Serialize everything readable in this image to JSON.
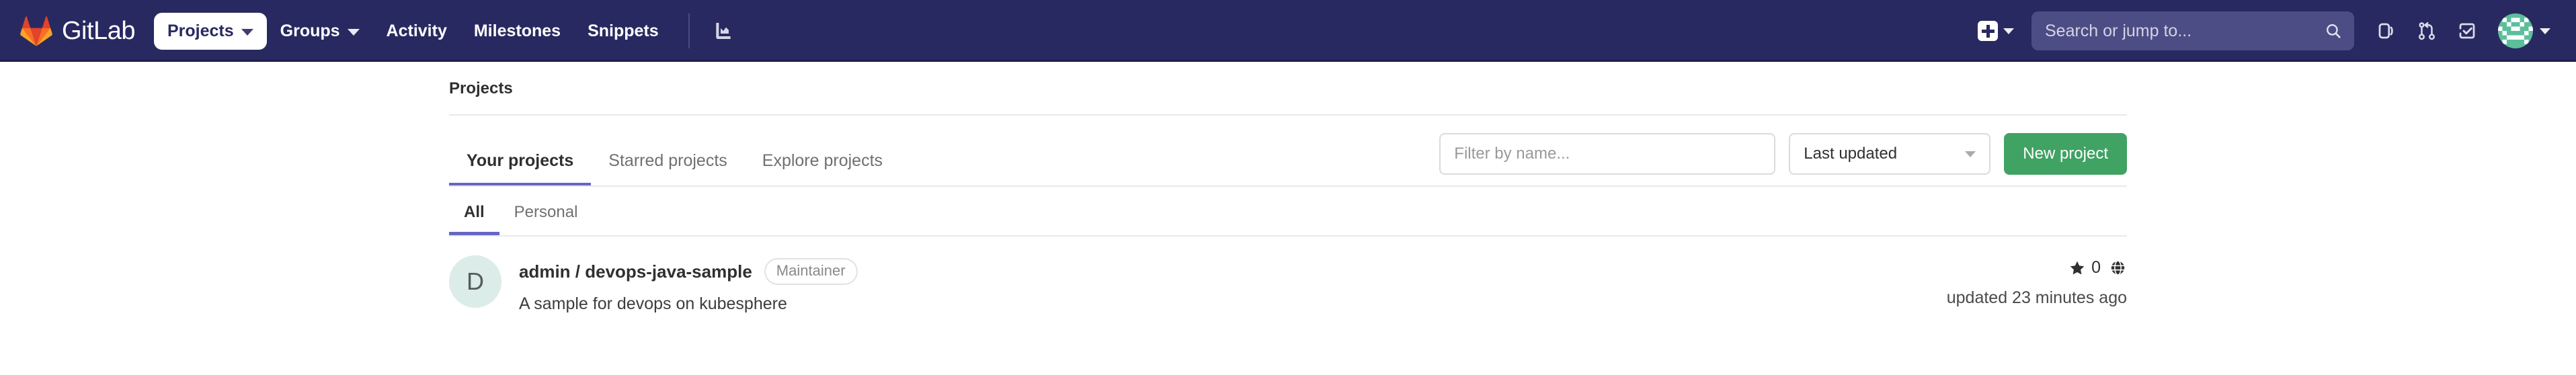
{
  "navbar": {
    "brand_name": "GitLab",
    "brand_icon": "gitlab-tanuki-logo",
    "items": [
      {
        "label": "Projects",
        "icon": "chevron-down-icon",
        "active": true,
        "has_caret": true
      },
      {
        "label": "Groups",
        "icon": "chevron-down-icon",
        "active": false,
        "has_caret": true
      },
      {
        "label": "Activity",
        "active": false,
        "has_caret": false
      },
      {
        "label": "Milestones",
        "active": false,
        "has_caret": false
      },
      {
        "label": "Snippets",
        "active": false,
        "has_caret": false
      }
    ],
    "analytics_icon": "analytics-chart-icon",
    "create_new_icon": "plus-square-icon",
    "create_new_caret_icon": "chevron-down-icon",
    "search": {
      "placeholder": "Search or jump to...",
      "value": "",
      "icon": "search-icon"
    },
    "right_icons": [
      {
        "name": "issues-icon"
      },
      {
        "name": "merge-requests-icon"
      },
      {
        "name": "todos-icon"
      }
    ],
    "avatar": {
      "name": "user-avatar",
      "caret_icon": "chevron-down-icon"
    },
    "bg_color": "#292961",
    "search_bg_color": "#4d4d85"
  },
  "breadcrumb": {
    "label": "Projects"
  },
  "tabs": [
    {
      "label": "Your projects",
      "active": true
    },
    {
      "label": "Starred projects",
      "active": false
    },
    {
      "label": "Explore projects",
      "active": false
    }
  ],
  "filter": {
    "placeholder": "Filter by name...",
    "value": ""
  },
  "sort": {
    "selected": "Last updated",
    "caret_icon": "chevron-down-icon"
  },
  "new_project_button": {
    "label": "New project",
    "color": "#40a263"
  },
  "subtabs": [
    {
      "label": "All",
      "active": true
    },
    {
      "label": "Personal",
      "active": false
    }
  ],
  "projects": [
    {
      "avatar_letter": "D",
      "avatar_bg": "#dcece8",
      "name": "admin / devops-java-sample",
      "role_badge": "Maintainer",
      "description": "A sample for devops on kubesphere",
      "stars": "0",
      "star_icon": "star-icon",
      "visibility_icon": "globe-icon",
      "updated": "updated 23 minutes ago"
    }
  ],
  "accent_color": "#6666c4"
}
